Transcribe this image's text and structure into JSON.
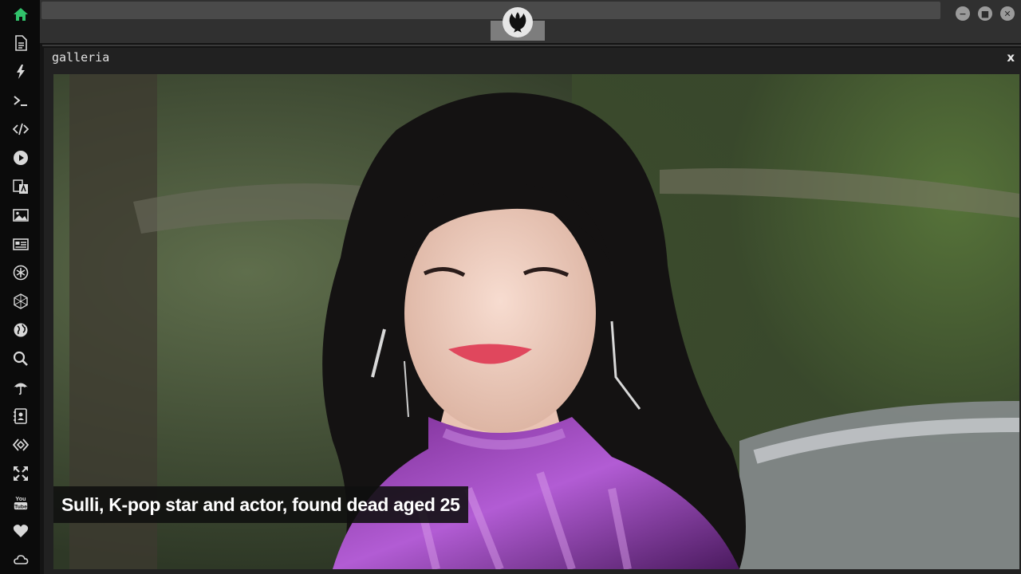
{
  "sidebar": {
    "items": [
      {
        "name": "home-icon",
        "active": true
      },
      {
        "name": "document-icon"
      },
      {
        "name": "lightning-icon"
      },
      {
        "name": "terminal-icon",
        "glyph": ">_"
      },
      {
        "name": "code-icon",
        "glyph": "</>"
      },
      {
        "name": "play-icon"
      },
      {
        "name": "translate-icon"
      },
      {
        "name": "image-icon"
      },
      {
        "name": "newspaper-icon"
      },
      {
        "name": "asterisk-icon"
      },
      {
        "name": "hexagon-icon"
      },
      {
        "name": "globe-icon"
      },
      {
        "name": "search-icon"
      },
      {
        "name": "umbrella-icon"
      },
      {
        "name": "contact-card-icon"
      },
      {
        "name": "code-diamond-icon"
      },
      {
        "name": "expand-icon"
      },
      {
        "name": "youtube-icon",
        "glyph": "You\nTube"
      },
      {
        "name": "heart-icon"
      },
      {
        "name": "cloud-icon"
      }
    ]
  },
  "window": {
    "title": "galleria",
    "close_label": "x"
  },
  "gallery": {
    "caption": "Sulli, K-pop star and actor, found dead aged 25"
  },
  "topbar": {
    "minimize_label": "−",
    "maximize_label": "■",
    "close_label": "✕"
  },
  "colors": {
    "accent": "#31c26b",
    "sidebar_bg": "#0b0b0b",
    "topbar_bg": "#303030",
    "window_bg": "#212121"
  }
}
